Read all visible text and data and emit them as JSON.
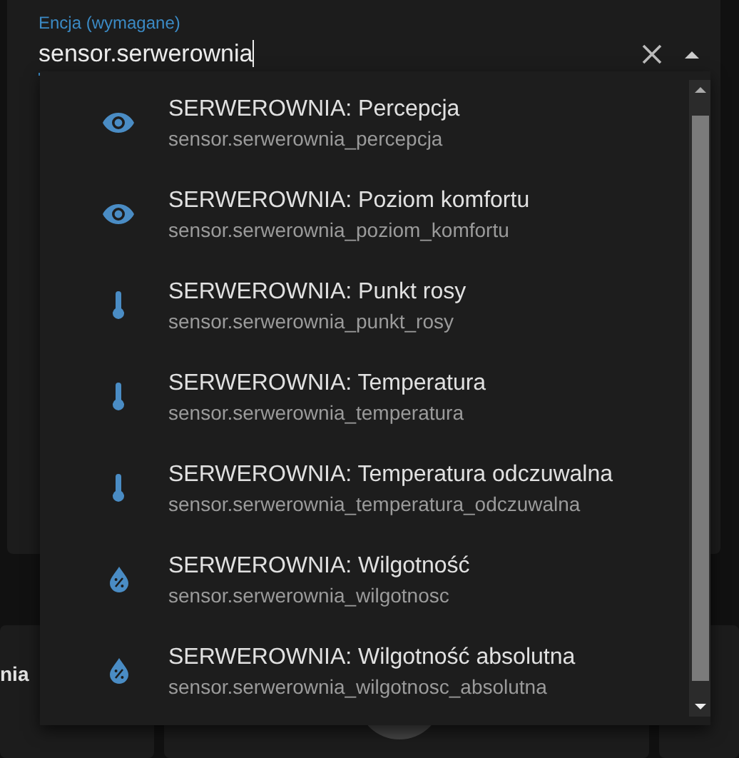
{
  "entity_field": {
    "label": "Encja (wymagane)",
    "value": "sensor.serwerownia"
  },
  "dropdown": {
    "items": [
      {
        "kind": "eye",
        "title": "SERWEROWNIA: Percepcja",
        "entity": "sensor.serwerownia_percepcja"
      },
      {
        "kind": "eye",
        "title": "SERWEROWNIA: Poziom komfortu",
        "entity": "sensor.serwerownia_poziom_komfortu"
      },
      {
        "kind": "thermometer",
        "title": "SERWEROWNIA: Punkt rosy",
        "entity": "sensor.serwerownia_punkt_rosy"
      },
      {
        "kind": "thermometer",
        "title": "SERWEROWNIA: Temperatura",
        "entity": "sensor.serwerownia_temperatura"
      },
      {
        "kind": "thermometer",
        "title": "SERWEROWNIA: Temperatura odczuwalna",
        "entity": "sensor.serwerownia_temperatura_odczuwalna"
      },
      {
        "kind": "drop",
        "title": "SERWEROWNIA: Wilgotność",
        "entity": "sensor.serwerownia_wilgotnosc"
      },
      {
        "kind": "drop",
        "title": "SERWEROWNIA: Wilgotność absolutna",
        "entity": "sensor.serwerownia_wilgotnosc_absolutna"
      }
    ]
  },
  "background_card": {
    "text": "nia"
  }
}
